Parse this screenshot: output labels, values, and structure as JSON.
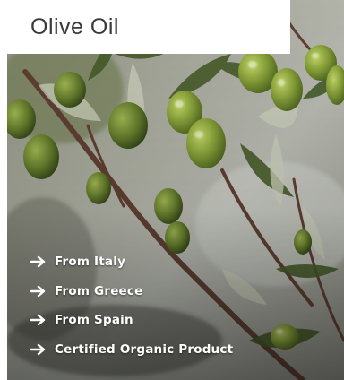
{
  "header": {
    "title": "Olive Oil"
  },
  "features": [
    {
      "label": "From Italy",
      "icon": "arrow-right-icon"
    },
    {
      "label": "From Greece",
      "icon": "arrow-right-icon"
    },
    {
      "label": "From Spain",
      "icon": "arrow-right-icon"
    },
    {
      "label": "Certified Organic Product",
      "icon": "arrow-right-icon"
    }
  ],
  "colors": {
    "title_text": "#3a3a3a",
    "feature_text": "#ffffff",
    "olive_green": "#7f9a2c",
    "leaf_green": "#3f5227",
    "branch_brown": "#6e4a3a"
  }
}
